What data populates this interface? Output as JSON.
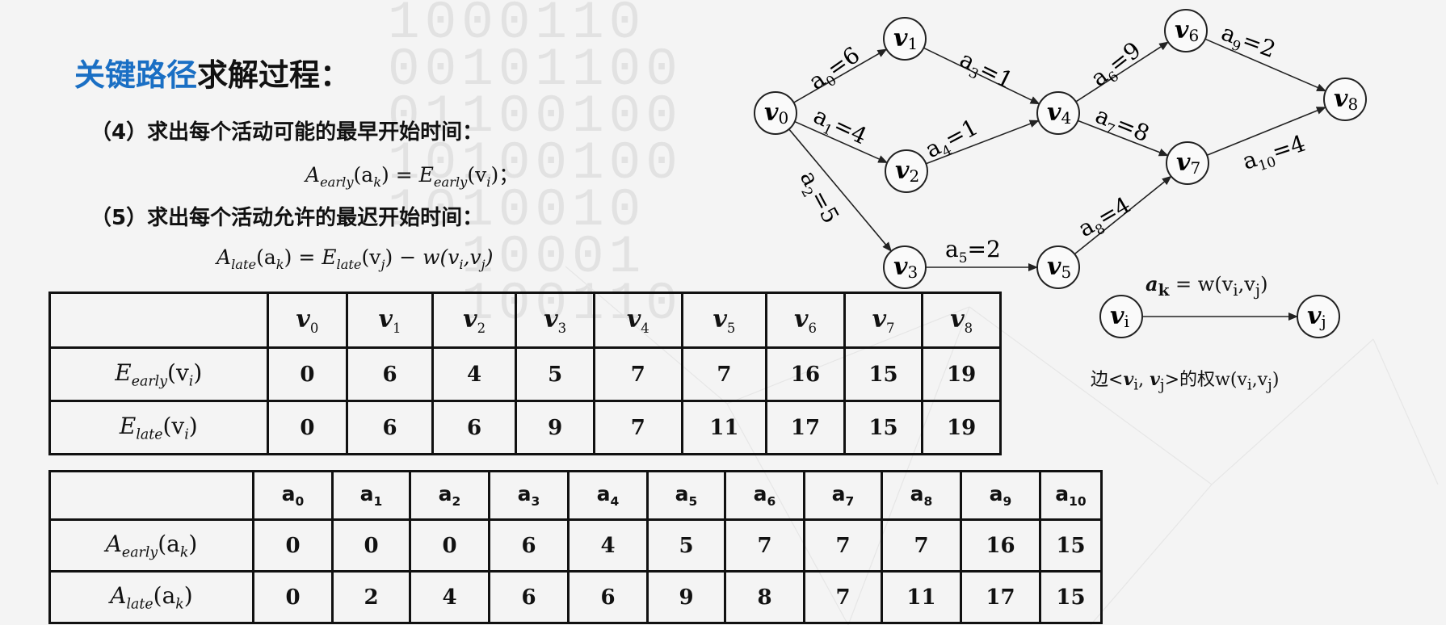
{
  "heading": {
    "blue_part": "关键路径",
    "rest": "求解过程："
  },
  "step4": {
    "label": "（4）求出每个活动可能的最早开始时间：",
    "formula": {
      "lhs_fn": "A",
      "lhs_sub": "early",
      "lhs_arg": "(a",
      "lhs_arg_sub": "k",
      "lhs_close": ")",
      "eq": " = ",
      "rhs_fn": "E",
      "rhs_sub": "early",
      "rhs_arg": "(v",
      "rhs_arg_sub": "i",
      "rhs_close": ")",
      "end": "；"
    }
  },
  "step5": {
    "label": "（5）求出每个活动允许的最迟开始时间：",
    "formula": {
      "lhs_fn": "A",
      "lhs_sub": "late",
      "lhs_arg": "(a",
      "lhs_arg_sub": "k",
      "lhs_close": ")",
      "eq": " = ",
      "rhs_fn": "E",
      "rhs_sub": "late",
      "rhs_arg": "(v",
      "rhs_arg_sub": "j",
      "rhs_close": ")",
      "minus": " − ",
      "w": "w(v",
      "w_sub1": "i",
      "w_mid": ",v",
      "w_sub2": "j",
      "w_close": ")"
    }
  },
  "vertex_table": {
    "headers": [
      {
        "b": "v",
        "s": "0"
      },
      {
        "b": "v",
        "s": "1"
      },
      {
        "b": "v",
        "s": "2"
      },
      {
        "b": "v",
        "s": "3"
      },
      {
        "b": "v",
        "s": "4"
      },
      {
        "b": "v",
        "s": "5"
      },
      {
        "b": "v",
        "s": "6"
      },
      {
        "b": "v",
        "s": "7"
      },
      {
        "b": "v",
        "s": "8"
      }
    ],
    "rows": [
      {
        "head": {
          "fn": "E",
          "sub": "early",
          "arg": "(v",
          "argsub": "i",
          "close": ")"
        },
        "values": [
          "0",
          "6",
          "4",
          "5",
          "7",
          "7",
          "16",
          "15",
          "19"
        ]
      },
      {
        "head": {
          "fn": "E",
          "sub": "late",
          "arg": "(v",
          "argsub": "i",
          "close": ")"
        },
        "values": [
          "0",
          "6",
          "6",
          "9",
          "7",
          "11",
          "17",
          "15",
          "19"
        ]
      }
    ]
  },
  "activity_table": {
    "headers": [
      {
        "b": "a",
        "s": "0"
      },
      {
        "b": "a",
        "s": "1"
      },
      {
        "b": "a",
        "s": "2"
      },
      {
        "b": "a",
        "s": "3"
      },
      {
        "b": "a",
        "s": "4"
      },
      {
        "b": "a",
        "s": "5"
      },
      {
        "b": "a",
        "s": "6"
      },
      {
        "b": "a",
        "s": "7"
      },
      {
        "b": "a",
        "s": "8"
      },
      {
        "b": "a",
        "s": "9"
      },
      {
        "b": "a",
        "s": "10"
      }
    ],
    "rows": [
      {
        "head": {
          "fn": "A",
          "sub": "early",
          "arg": "(a",
          "argsub": "k",
          "close": ")"
        },
        "values": [
          "0",
          "0",
          "0",
          "6",
          "4",
          "5",
          "7",
          "7",
          "7",
          "16",
          "15"
        ]
      },
      {
        "head": {
          "fn": "A",
          "sub": "late",
          "arg": "(a",
          "argsub": "k",
          "close": ")"
        },
        "values": [
          "0",
          "2",
          "4",
          "6",
          "6",
          "9",
          "8",
          "7",
          "11",
          "17",
          "15"
        ]
      }
    ]
  },
  "graph": {
    "nodes": [
      {
        "id": "v0",
        "b": "v",
        "s": "0"
      },
      {
        "id": "v1",
        "b": "v",
        "s": "1"
      },
      {
        "id": "v2",
        "b": "v",
        "s": "2"
      },
      {
        "id": "v3",
        "b": "v",
        "s": "3"
      },
      {
        "id": "v4",
        "b": "v",
        "s": "4"
      },
      {
        "id": "v5",
        "b": "v",
        "s": "5"
      },
      {
        "id": "v6",
        "b": "v",
        "s": "6"
      },
      {
        "id": "v7",
        "b": "v",
        "s": "7"
      },
      {
        "id": "v8",
        "b": "v",
        "s": "8"
      }
    ],
    "edges": [
      {
        "from": "v0",
        "to": "v1",
        "name": "a",
        "sub": "0",
        "weight": "6"
      },
      {
        "from": "v0",
        "to": "v2",
        "name": "a",
        "sub": "1",
        "weight": "4"
      },
      {
        "from": "v0",
        "to": "v3",
        "name": "a",
        "sub": "2",
        "weight": "5"
      },
      {
        "from": "v1",
        "to": "v4",
        "name": "a",
        "sub": "3",
        "weight": "1"
      },
      {
        "from": "v2",
        "to": "v4",
        "name": "a",
        "sub": "4",
        "weight": "1"
      },
      {
        "from": "v3",
        "to": "v5",
        "name": "a",
        "sub": "5",
        "weight": "2"
      },
      {
        "from": "v4",
        "to": "v6",
        "name": "a",
        "sub": "6",
        "weight": "9"
      },
      {
        "from": "v4",
        "to": "v7",
        "name": "a",
        "sub": "7",
        "weight": "8"
      },
      {
        "from": "v5",
        "to": "v7",
        "name": "a",
        "sub": "8",
        "weight": "4"
      },
      {
        "from": "v6",
        "to": "v8",
        "name": "a",
        "sub": "9",
        "weight": "2"
      },
      {
        "from": "v7",
        "to": "v8",
        "name": "a",
        "sub": "10",
        "weight": "4"
      }
    ]
  },
  "legend": {
    "formula": {
      "a": "a",
      "a_sub": "k",
      "eq": " = w(v",
      "s1": "i",
      "mid": ",v",
      "s2": "j",
      "close": ")"
    },
    "from": {
      "b": "v",
      "s": "i"
    },
    "to": {
      "b": "v",
      "s": "j"
    },
    "caption": {
      "pre": "边<",
      "v1": "v",
      "s1": "i",
      "comma": ", ",
      "v2": "v",
      "s2": "j",
      "post": ">的权",
      "w": "w(v",
      "ws1": "i",
      "wmid": ",v",
      "ws2": "j",
      "wclose": ")"
    }
  },
  "background_digits": "1000110\n00101100\n01100100\n10100100\n1010010\n  10001\n  100110"
}
